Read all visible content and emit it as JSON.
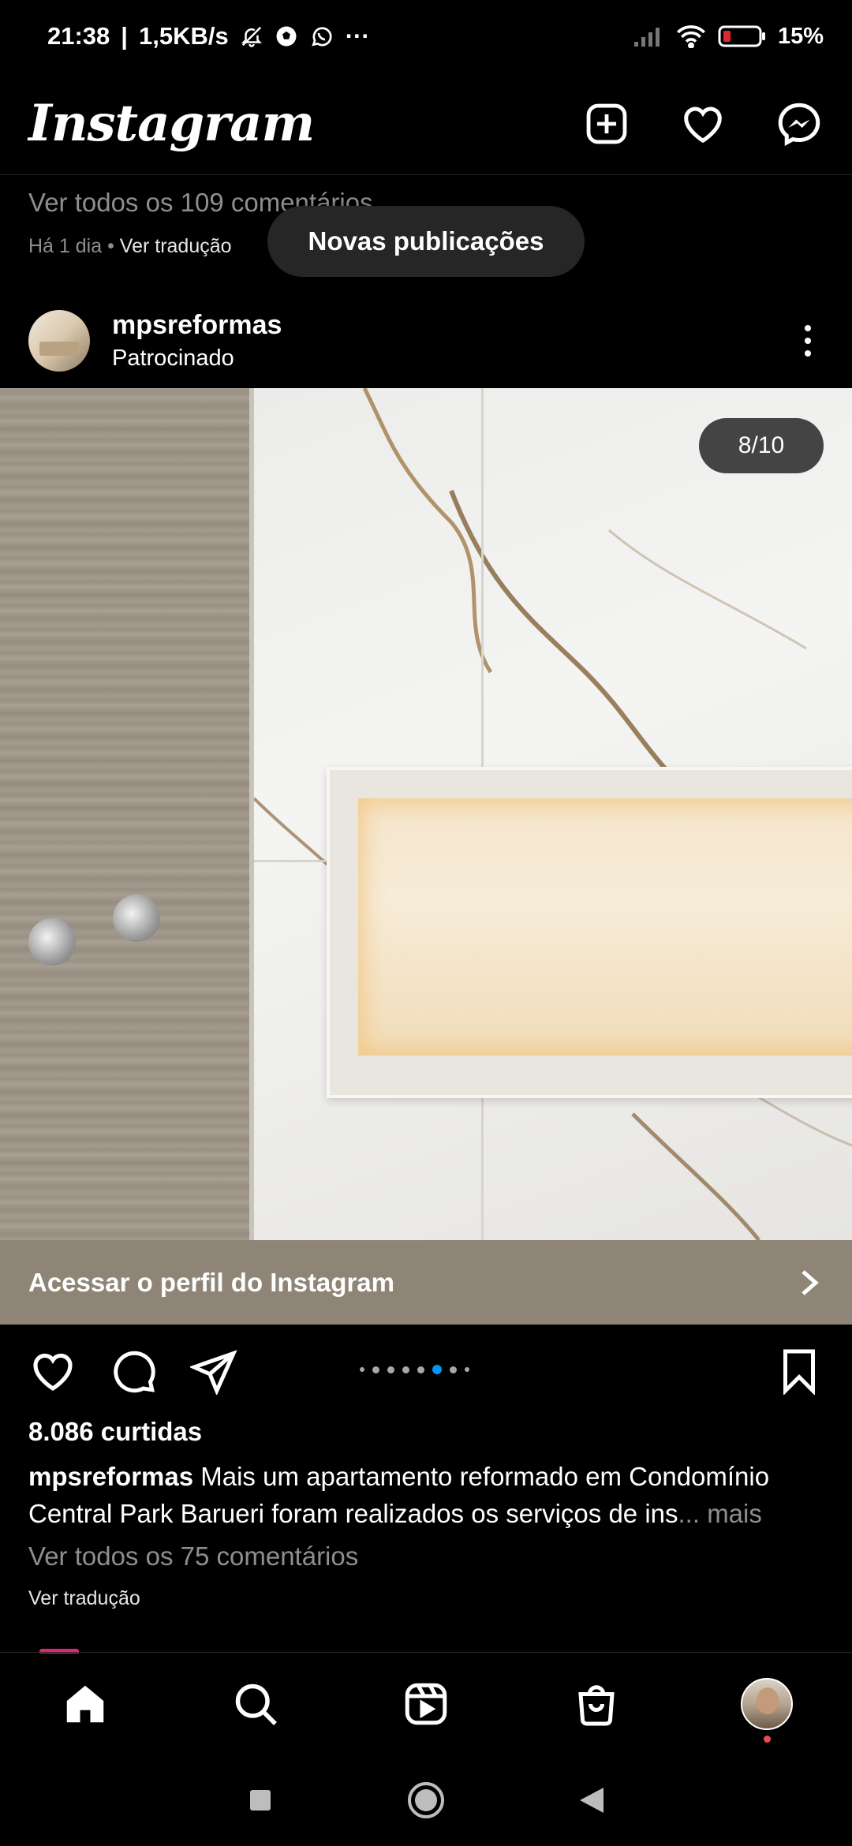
{
  "status_bar": {
    "time": "21:38",
    "network_speed": "1,5KB/s",
    "overflow": "···",
    "battery": "15%",
    "icons": [
      "bell-off-icon",
      "soccer-ball-icon",
      "whatsapp-icon",
      "signal-icon",
      "wifi-icon",
      "battery-icon"
    ]
  },
  "header": {
    "logo": "Instagram",
    "icons": [
      "new-post-icon",
      "heart-icon",
      "messenger-icon"
    ]
  },
  "previous_post": {
    "view_comments": "Ver todos os 109 comentários",
    "time": "Há 1 dia",
    "separator": " • ",
    "translate": "Ver tradução"
  },
  "new_posts_pill": "Novas publicações",
  "post": {
    "username": "mpsreformas",
    "subtitle": "Patrocinado",
    "carousel_counter": "8/10",
    "carousel_total": 10,
    "carousel_current": 8,
    "cta": "Acessar o perfil do Instagram",
    "likes": "8.086 curtidas",
    "caption_user": "mpsreformas",
    "caption_text": " Mais um apartamento reformado em Condomínio Central Park Barueri foram realizados os serviços de ins",
    "caption_more": "... mais",
    "view_comments": "Ver todos os 75 comentários",
    "translate": "Ver tradução"
  },
  "bottom_nav": [
    "home-icon",
    "search-icon",
    "reels-icon",
    "shop-icon",
    "profile-avatar"
  ],
  "system_nav": [
    "recents-icon",
    "home-circle-icon",
    "back-icon"
  ],
  "colors": {
    "background": "#000000",
    "secondary_text": "#8e8e8e",
    "cta_bar": "#8e8576",
    "active_dot": "#0095f6",
    "notification": "#ed4956"
  }
}
